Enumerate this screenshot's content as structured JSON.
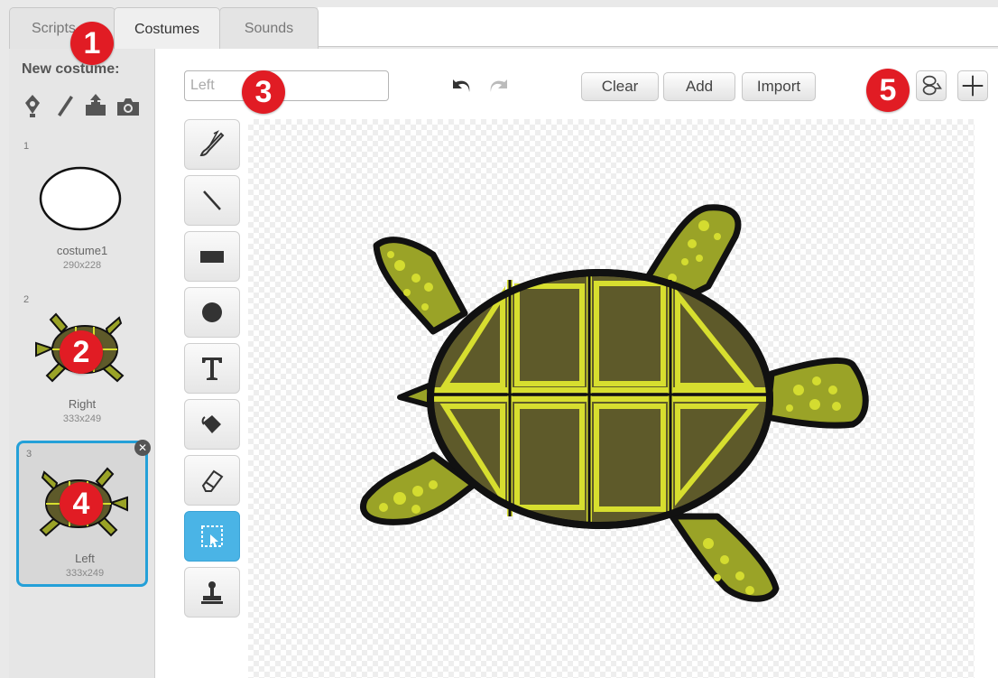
{
  "tabs": [
    {
      "label": "Scripts"
    },
    {
      "label": "Costumes"
    },
    {
      "label": "Sounds"
    }
  ],
  "new_costume": {
    "label": "New costume:",
    "icons": [
      "paint-from-library-icon",
      "paint-new-icon",
      "upload-icon",
      "camera-icon"
    ]
  },
  "costumes": [
    {
      "num": "1",
      "name": "costume1",
      "size": "290x228"
    },
    {
      "num": "2",
      "name": "Right",
      "size": "333x249"
    },
    {
      "num": "3",
      "name": "Left",
      "size": "333x249"
    }
  ],
  "editor": {
    "costume_name": "Left",
    "buttons": {
      "clear": "Clear",
      "add": "Add",
      "import": "Import"
    }
  },
  "tools": [
    "brush-icon",
    "line-icon",
    "rectangle-icon",
    "ellipse-icon",
    "text-icon",
    "fill-icon",
    "eraser-icon",
    "select-icon",
    "stamp-icon"
  ],
  "callouts": [
    "1",
    "2",
    "3",
    "4",
    "5"
  ],
  "colors": {
    "selected": "#24a0d8",
    "callout": "#e11c24",
    "shell": "#5e5a2a",
    "shell_lines": "#d7de2f",
    "skin": "#9aa327",
    "spots": "#d4dc30"
  }
}
